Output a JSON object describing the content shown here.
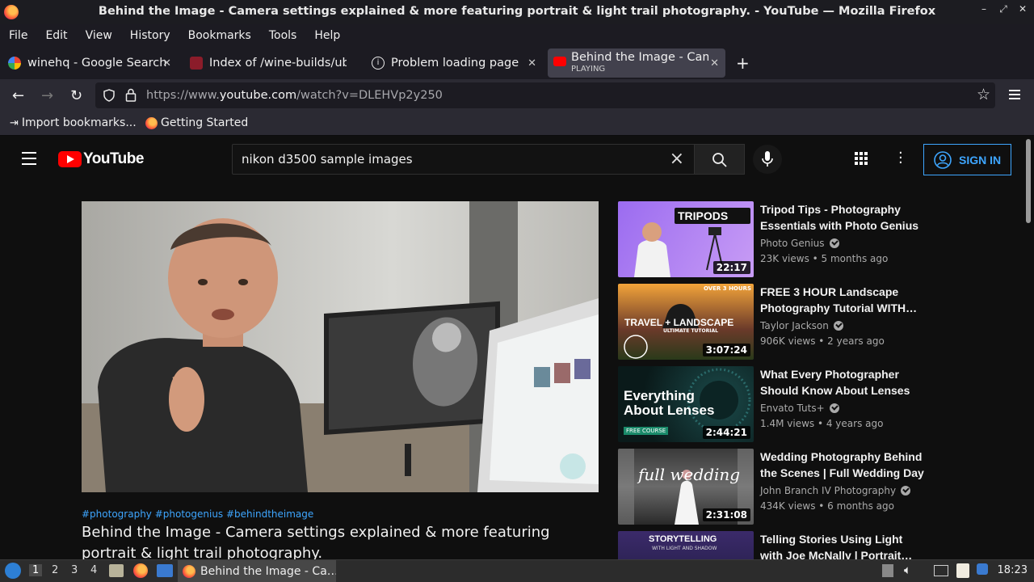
{
  "window": {
    "title": "Behind the Image - Camera settings explained & more featuring portrait & light trail photography. - YouTube — Mozilla Firefox"
  },
  "menu": [
    "File",
    "Edit",
    "View",
    "History",
    "Bookmarks",
    "Tools",
    "Help"
  ],
  "tabs": [
    {
      "label": "winehq - Google Search"
    },
    {
      "label": "Index of /wine-builds/ubu"
    },
    {
      "label": "Problem loading page"
    },
    {
      "label": "Behind the Image - Came",
      "sub": "PLAYING"
    }
  ],
  "url": {
    "prefix": "https://www.",
    "domain": "youtube.com",
    "path": "/watch?v=DLEHVp2y250"
  },
  "bookmarks": [
    "Import bookmarks...",
    "Getting Started"
  ],
  "youtube": {
    "logo_text": "YouTube",
    "search_query": "nikon d3500 sample images",
    "signin_label": "SIGN IN",
    "accent": "#3ea6ff",
    "brand": "#ff0000"
  },
  "video": {
    "hashtags": "#photography #photogenius #behindtheimage",
    "title": "Behind the Image - Camera settings explained & more featuring portrait & light trail photography."
  },
  "related": [
    {
      "title": "Tripod Tips - Photography Essentials with Photo Genius",
      "channel": "Photo Genius",
      "meta": "23K views • 5 months ago",
      "duration": "22:17",
      "thumb_text": "TRIPODS"
    },
    {
      "title": "FREE 3 HOUR Landscape Photography Tutorial WITH…",
      "channel": "Taylor Jackson",
      "meta": "906K views • 2 years ago",
      "duration": "3:07:24",
      "thumb_text": "TRAVEL + LANDSCAPE",
      "thumb_sub": "ULTIMATE TUTORIAL",
      "thumb_badge": "OVER 3 HOURS"
    },
    {
      "title": "What Every Photographer Should Know About Lenses",
      "channel": "Envato Tuts+",
      "meta": "1.4M views • 4 years ago",
      "duration": "2:44:21",
      "thumb_text": "Everything About Lenses",
      "thumb_sub": "FREE COURSE"
    },
    {
      "title": "Wedding Photography Behind the Scenes | Full Wedding Day …",
      "channel": "John Branch IV Photography",
      "meta": "434K views • 6 months ago",
      "duration": "2:31:08",
      "thumb_text": "full wedding"
    },
    {
      "title": "Telling Stories Using Light with Joe McNally | Portrait…",
      "channel": "",
      "meta": "",
      "duration": "",
      "thumb_text": "STORYTELLING",
      "thumb_sub": "WITH LIGHT AND SHADOW"
    }
  ],
  "taskbar": {
    "workspaces": [
      "1",
      "2",
      "3",
      "4"
    ],
    "task_label": "Behind the Image - Ca…",
    "clock": "18:23"
  }
}
